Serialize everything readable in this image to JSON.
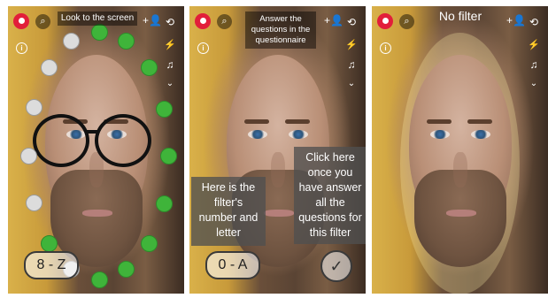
{
  "panels": [
    {
      "id": "camera-dots",
      "top_label": "Look to the screen",
      "filter_code": "8 - Z"
    },
    {
      "id": "questionnaire",
      "top_label": "Answer the questions in the questionnaire",
      "filter_code": "0 - A",
      "callout_left": "Here is the filter's number and letter",
      "callout_right": "Click here once you have answer all the questions for this filter"
    },
    {
      "id": "no-filter",
      "top_label": "No filter"
    }
  ],
  "icons": {
    "avatar": "avatar-icon",
    "search": "search-icon",
    "info": "info-icon",
    "add_friend": "add-friend-icon",
    "flip_camera": "flip-camera-icon",
    "flash": "flash-icon",
    "music": "music-icon",
    "more": "chevron-down-icon",
    "check": "check-icon"
  },
  "colors": {
    "avatar_red": "#e21e3a",
    "dot_green": "#3fb43a",
    "dot_white": "#dcdcdc"
  }
}
